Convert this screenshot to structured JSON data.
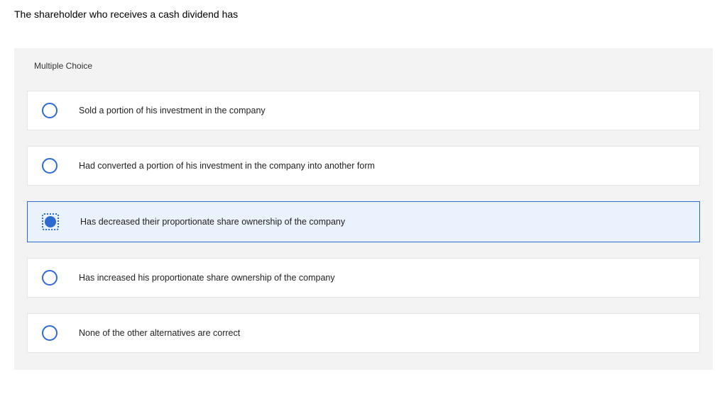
{
  "question": {
    "text": "The shareholder who receives a cash dividend has"
  },
  "quiz": {
    "header": "Multiple Choice",
    "selectedIndex": 2,
    "options": [
      {
        "label": "Sold a portion of his investment in the company"
      },
      {
        "label": "Had converted a portion of his investment in the company into another form"
      },
      {
        "label": "Has decreased their proportionate share ownership of the company"
      },
      {
        "label": "Has increased his proportionate share ownership of the company"
      },
      {
        "label": "None of the other alternatives are correct"
      }
    ]
  }
}
